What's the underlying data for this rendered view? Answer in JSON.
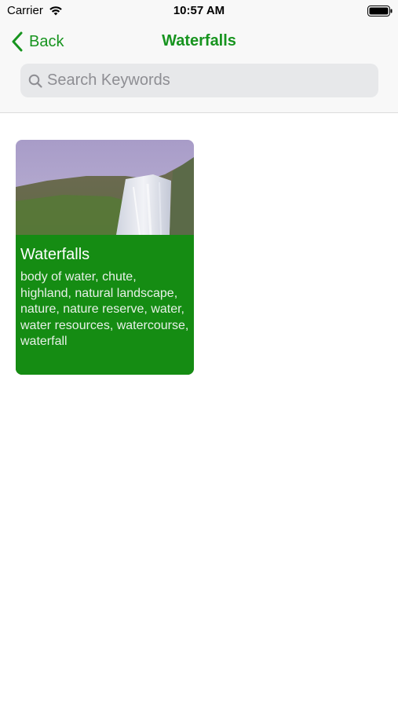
{
  "status_bar": {
    "carrier": "Carrier",
    "time": "10:57 AM",
    "wifi_icon": "wifi-icon",
    "battery_icon": "battery-icon"
  },
  "nav": {
    "back_label": "Back",
    "title": "Waterfalls",
    "back_icon": "chevron-left-icon"
  },
  "search": {
    "placeholder": "Search Keywords",
    "value": "",
    "icon": "search-icon"
  },
  "colors": {
    "accent": "#17941f",
    "card_overlay": "#108c10",
    "search_bg": "#e7e8ea"
  },
  "cards": [
    {
      "title": "Waterfalls",
      "keywords": "body of water, chute, highland, natural landscape, nature, nature reserve, water, water resources, watercourse, waterfall"
    }
  ]
}
